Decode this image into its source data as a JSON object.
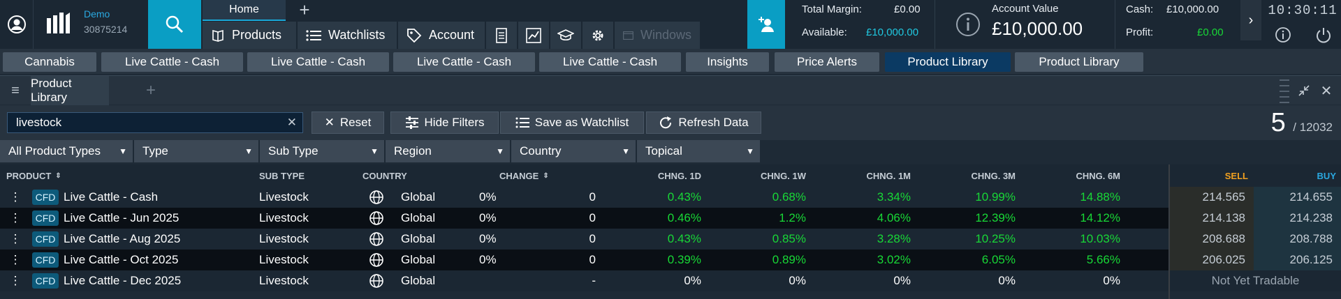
{
  "account_type": "Demo",
  "account_number": "30875214",
  "home_tab": "Home",
  "nav": {
    "products": "Products",
    "watchlists": "Watchlists",
    "account": "Account",
    "windows": "Windows"
  },
  "summary": {
    "total_margin_label": "Total Margin:",
    "total_margin_value": "£0.00",
    "available_label": "Available:",
    "available_value": "£10,000.00",
    "account_value_label": "Account Value",
    "account_value": "£10,000.00",
    "cash_label": "Cash:",
    "cash_value": "£10,000.00",
    "profit_label": "Profit:",
    "profit_value": "£0.00"
  },
  "clock": "10:30:11",
  "workspace_tabs": [
    {
      "label": "Cannabis",
      "active": false
    },
    {
      "label": "Live Cattle - Cash",
      "active": false
    },
    {
      "label": "Live Cattle - Cash",
      "active": false
    },
    {
      "label": "Live Cattle - Cash",
      "active": false
    },
    {
      "label": "Live Cattle - Cash",
      "active": false
    },
    {
      "label": "Insights",
      "active": false
    },
    {
      "label": "Price Alerts",
      "active": false
    },
    {
      "label": "Product Library",
      "active": true
    },
    {
      "label": "Product Library",
      "active": false
    }
  ],
  "panel_tab": "Product Library",
  "toolbar": {
    "search_value": "livestock",
    "reset": "Reset",
    "hide_filters": "Hide Filters",
    "save_watchlist": "Save as Watchlist",
    "refresh": "Refresh Data",
    "count": "5",
    "total": "/ 12032"
  },
  "filters": [
    "All Product Types",
    "Type",
    "Sub Type",
    "Region",
    "Country",
    "Topical"
  ],
  "columns": {
    "product": "PRODUCT",
    "sub_type": "SUB TYPE",
    "country": "COUNTRY",
    "change": "CHANGE",
    "chng_1d": "CHNG. 1D",
    "chng_1w": "CHNG. 1W",
    "chng_1m": "CHNG. 1M",
    "chng_3m": "CHNG. 3M",
    "chng_6m": "CHNG. 6M",
    "sell": "SELL",
    "buy": "BUY"
  },
  "colors": {
    "sell_header": "#f0a020",
    "buy_header": "#2aa8e0",
    "positive": "#18d836",
    "accent": "#0a9ec4"
  },
  "rows": [
    {
      "badge": "CFD",
      "name": "Live Cattle - Cash",
      "sub_type": "Livestock",
      "country": "Global",
      "change_pct": "0%",
      "change": "0",
      "d1": "0.43%",
      "w1": "0.68%",
      "m1": "3.34%",
      "m3": "10.99%",
      "m6": "14.88%",
      "sell": "214.565",
      "buy": "214.655"
    },
    {
      "badge": "CFD",
      "name": "Live Cattle - Jun 2025",
      "sub_type": "Livestock",
      "country": "Global",
      "change_pct": "0%",
      "change": "0",
      "d1": "0.46%",
      "w1": "1.2%",
      "m1": "4.06%",
      "m3": "12.39%",
      "m6": "14.12%",
      "sell": "214.138",
      "buy": "214.238"
    },
    {
      "badge": "CFD",
      "name": "Live Cattle - Aug 2025",
      "sub_type": "Livestock",
      "country": "Global",
      "change_pct": "0%",
      "change": "0",
      "d1": "0.43%",
      "w1": "0.85%",
      "m1": "3.28%",
      "m3": "10.25%",
      "m6": "10.03%",
      "sell": "208.688",
      "buy": "208.788"
    },
    {
      "badge": "CFD",
      "name": "Live Cattle - Oct 2025",
      "sub_type": "Livestock",
      "country": "Global",
      "change_pct": "0%",
      "change": "0",
      "d1": "0.39%",
      "w1": "0.89%",
      "m1": "3.02%",
      "m3": "6.05%",
      "m6": "5.66%",
      "sell": "206.025",
      "buy": "206.125"
    },
    {
      "badge": "CFD",
      "name": "Live Cattle - Dec 2025",
      "sub_type": "Livestock",
      "country": "Global",
      "change_pct": "",
      "change": "-",
      "d1": "0%",
      "w1": "0%",
      "m1": "0%",
      "m3": "0%",
      "m6": "0%",
      "status": "Not Yet Tradable"
    }
  ]
}
